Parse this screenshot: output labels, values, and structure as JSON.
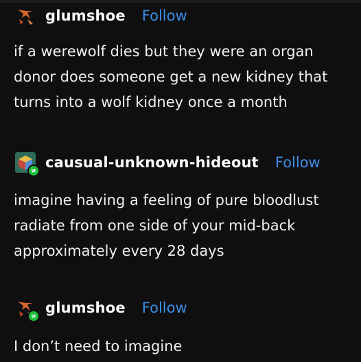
{
  "posts": [
    {
      "username": "glumshoe",
      "follow_label": "Follow",
      "text_lines": [
        "if a werewolf dies but they were an organ",
        "donor does someone get a new kidney that",
        "turns into a wolf kidney once a month"
      ]
    },
    {
      "username": "causual-unknown-hideout",
      "follow_label": "Follow",
      "text_lines": [
        "imagine having a feeling of pure bloodlust",
        "radiate from one side of your mid-back",
        "approximately every 28 days"
      ]
    },
    {
      "username": "glumshoe",
      "follow_label": "Follow",
      "text_lines": [
        "I don’t need to imagine"
      ]
    }
  ],
  "colors": {
    "background": "#0f0f10",
    "follow_link": "#3a8fe8",
    "reblog_badge": "#1dbf3a"
  }
}
